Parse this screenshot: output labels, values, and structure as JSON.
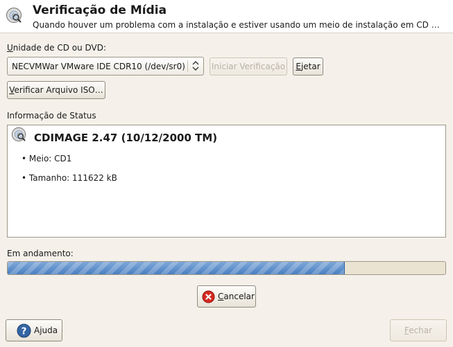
{
  "header": {
    "title": "Verificação de Mídia",
    "subtitle": "Quando houver um problema com a instalação e estiver usando um meio de instalação em CD …",
    "icon": "disc-check-icon"
  },
  "drive": {
    "label": "Unidade de CD ou DVD:",
    "selected": "NECVMWar VMware IDE CDR10 (/dev/sr0)"
  },
  "buttons": {
    "start_check": "Iniciar Verificação",
    "eject": "Ejetar",
    "verify_iso": "Verificar Arquivo ISO…",
    "cancel": "Cancelar",
    "help": "Ajuda",
    "close": "Fechar"
  },
  "status": {
    "label": "Informação de Status",
    "title": "CDIMAGE 2.47 (10/12/2000 TM)",
    "items": [
      "• Meio: CD1",
      "• Tamanho: 111622 kB"
    ]
  },
  "progress": {
    "label": "Em andamento:",
    "fraction": 0.77
  },
  "colors": {
    "background": "#f5f1ea",
    "progress_fill": "#4a7fc2",
    "cancel_icon": "#d42a20",
    "help_icon": "#3465a4"
  }
}
